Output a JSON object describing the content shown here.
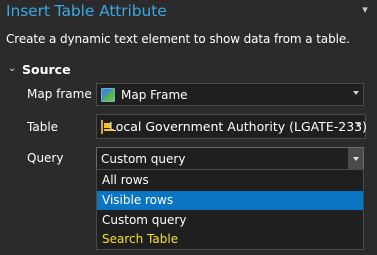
{
  "pane": {
    "title": "Insert Table Attribute",
    "pin_icon": "pin-icon",
    "description": "Create a dynamic text element to show data from a table."
  },
  "source": {
    "header": "Source",
    "chevron_icon": "chevron-down-icon",
    "map_frame": {
      "label": "Map frame",
      "value": "Map Frame",
      "icon": "map-frame-icon"
    },
    "table": {
      "label": "Table",
      "value": "Local Government Authority (LGATE-233)",
      "icon": "table-layer-icon"
    },
    "query": {
      "label": "Query",
      "value": "Custom query",
      "options": [
        {
          "label": "All rows"
        },
        {
          "label": "Visible rows",
          "selected": true
        },
        {
          "label": "Custom query"
        },
        {
          "label": "Search Table",
          "special": true
        }
      ]
    }
  },
  "colors": {
    "title": "#3aa7e6",
    "selection": "#0a75c2",
    "search_table": "#f0e332",
    "background": "#2b2b2b"
  }
}
